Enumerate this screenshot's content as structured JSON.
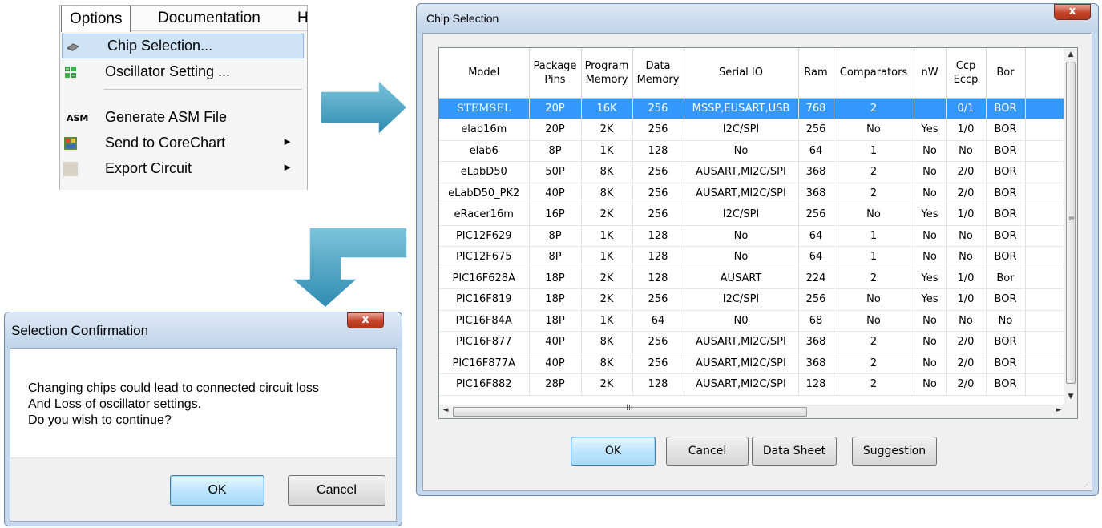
{
  "menu": {
    "menubar": [
      "Options",
      "Documentation",
      "H"
    ],
    "items": [
      {
        "label": "Chip Selection...",
        "icon": "chip-icon",
        "submenu": false
      },
      {
        "label": "Oscillator Setting ...",
        "icon": "oscillator-icon",
        "submenu": false
      },
      {
        "label": "Generate ASM File",
        "icon": "asm-icon",
        "icon_text": "ASM",
        "submenu": false
      },
      {
        "label": "Send to CoreChart",
        "icon": "corechart-icon",
        "submenu": true
      },
      {
        "label": "Export Circuit",
        "icon": "export-icon",
        "submenu": true
      }
    ],
    "submenu_arrow": "►"
  },
  "chip_dialog": {
    "title": "Chip Selection",
    "close_label": "x",
    "columns": [
      "Model",
      "Package Pins",
      "Program Memory",
      "Data Memory",
      "Serial IO",
      "Ram",
      "Comparators",
      "nW",
      "Ccp Eccp",
      "Bor"
    ],
    "rows": [
      [
        "STEMSEL",
        "20P",
        "16K",
        "256",
        "MSSP,EUSART,USB",
        "768",
        "2",
        "",
        "0/1",
        "BOR"
      ],
      [
        "elab16m",
        "20P",
        "2K",
        "256",
        "I2C/SPI",
        "256",
        "No",
        "Yes",
        "1/0",
        "BOR"
      ],
      [
        "elab6",
        "8P",
        "1K",
        "128",
        "No",
        "64",
        "1",
        "No",
        "No",
        "BOR"
      ],
      [
        "eLabD50",
        "50P",
        "8K",
        "256",
        "AUSART,MI2C/SPI",
        "368",
        "2",
        "No",
        "2/0",
        "BOR"
      ],
      [
        "eLabD50_PK2",
        "40P",
        "8K",
        "256",
        "AUSART,MI2C/SPI",
        "368",
        "2",
        "No",
        "2/0",
        "BOR"
      ],
      [
        "eRacer16m",
        "16P",
        "2K",
        "256",
        "I2C/SPI",
        "256",
        "No",
        "Yes",
        "1/0",
        "BOR"
      ],
      [
        "PIC12F629",
        "8P",
        "1K",
        "128",
        "No",
        "64",
        "1",
        "No",
        "No",
        "BOR"
      ],
      [
        "PIC12F675",
        "8P",
        "1K",
        "128",
        "No",
        "64",
        "1",
        "No",
        "No",
        "BOR"
      ],
      [
        "PIC16F628A",
        "18P",
        "2K",
        "128",
        "AUSART",
        "224",
        "2",
        "Yes",
        "1/0",
        "Bor"
      ],
      [
        "PIC16F819",
        "18P",
        "2K",
        "256",
        "I2C/SPI",
        "256",
        "No",
        "Yes",
        "1/0",
        "BOR"
      ],
      [
        "PIC16F84A",
        "18P",
        "1K",
        "64",
        "N0",
        "68",
        "No",
        "No",
        "No",
        "No"
      ],
      [
        "PIC16F877",
        "40P",
        "8K",
        "256",
        "AUSART,MI2C/SPI",
        "368",
        "2",
        "No",
        "2/0",
        "BOR"
      ],
      [
        "PIC16F877A",
        "40P",
        "8K",
        "256",
        "AUSART,MI2C/SPI",
        "368",
        "2",
        "No",
        "2/0",
        "BOR"
      ],
      [
        "PIC16F882",
        "28P",
        "2K",
        "128",
        "AUSART,MI2C/SPI",
        "128",
        "2",
        "No",
        "2/0",
        "BOR"
      ]
    ],
    "selected_row": 0,
    "scroll_grip": "≡",
    "hscroll_grip": "III",
    "buttons": {
      "ok": "OK",
      "cancel": "Cancel",
      "datasheet": "Data Sheet",
      "suggestion": "Suggestion"
    }
  },
  "confirm_dialog": {
    "title": "Selection Confirmation",
    "close_label": "x",
    "message_lines": [
      "Changing chips could lead to connected circuit loss",
      "And Loss of oscillator settings.",
      "Do you wish to continue?"
    ],
    "buttons": {
      "ok": "OK",
      "cancel": "Cancel"
    }
  },
  "colors": {
    "selection": "#3399ff",
    "menu_highlight": "#cfe3f7",
    "arrow": "#4aa3c3",
    "close_button": "#c4432a"
  }
}
